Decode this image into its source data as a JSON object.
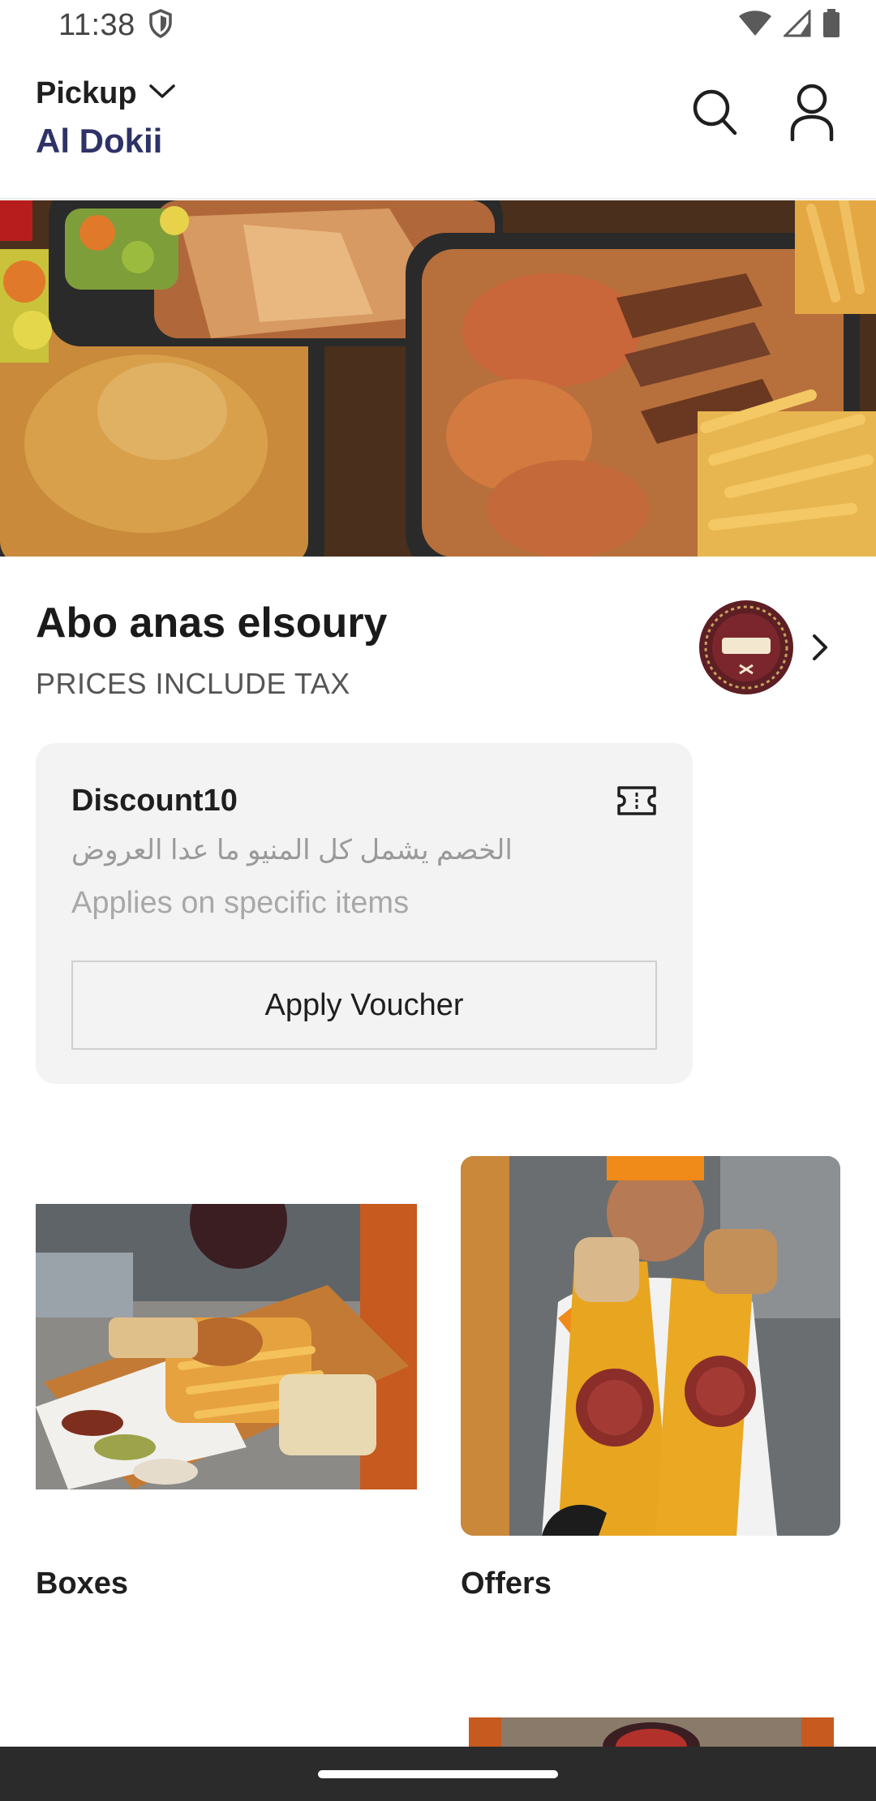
{
  "status": {
    "time": "11:38"
  },
  "header": {
    "mode_label": "Pickup",
    "branch_name": "Al Dokii"
  },
  "restaurant": {
    "name": "Abo anas elsoury",
    "tax_note": "PRICES INCLUDE TAX"
  },
  "voucher": {
    "code": "Discount10",
    "description": "الخصم يشمل كل المنيو ما عدا العروض",
    "scope": "Applies on specific items",
    "button_label": "Apply Voucher"
  },
  "categories": [
    {
      "label": "Boxes"
    },
    {
      "label": "Offers"
    }
  ],
  "colors": {
    "accent": "#2e3267",
    "card_bg": "#f3f3f3",
    "nav_bar": "#2b2b2b"
  }
}
